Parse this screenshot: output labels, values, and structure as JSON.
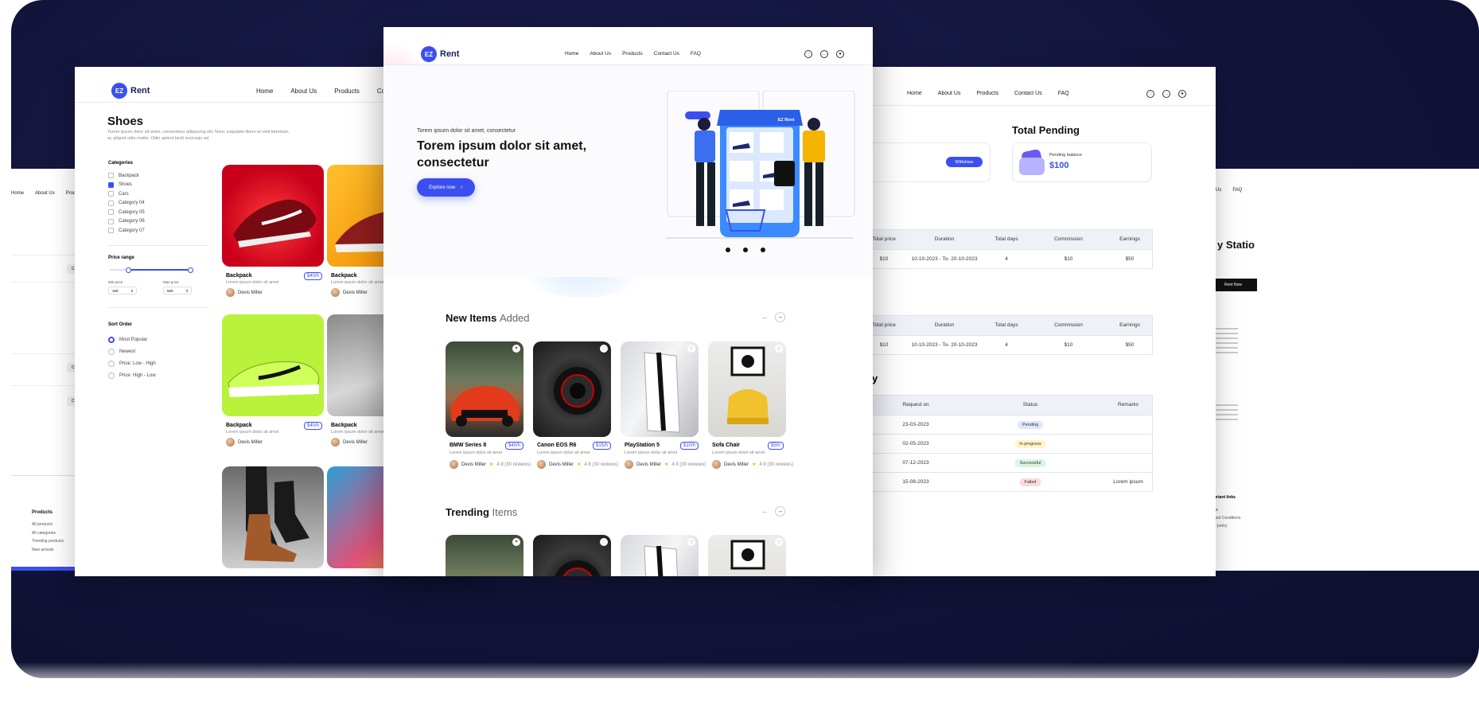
{
  "brand": {
    "name": "Rent",
    "mark": "EZ",
    "accent": "#3b4ff0",
    "dark": "#1b1f5e"
  },
  "nav": {
    "items": [
      "Home",
      "About Us",
      "Products",
      "Contact Us",
      "FAQ"
    ]
  },
  "shop_page": {
    "title": "Shoes",
    "intro_line1": "Torem ipsum dolor sit amet, consectetur adipiscing elit. Nunc vulputate libero et velit interdum,",
    "intro_line2": "ac aliquet odio mattis. Odio aptent taciti sociosqu ad",
    "categories_title": "Categories",
    "categories": [
      {
        "label": "Backpack",
        "checked": false
      },
      {
        "label": "Shoes",
        "checked": true
      },
      {
        "label": "Cars",
        "checked": false
      },
      {
        "label": "Category 04",
        "checked": false
      },
      {
        "label": "Category 05",
        "checked": false
      },
      {
        "label": "Category 06",
        "checked": false
      },
      {
        "label": "Category 07",
        "checked": false
      }
    ],
    "price_range_title": "Price range",
    "min_label": "Min price",
    "max_label": "Max price",
    "min_value": "100",
    "max_value": "500",
    "sort_title": "Sort Order",
    "sort_options": [
      {
        "label": "Most Popular",
        "selected": true
      },
      {
        "label": "Newest",
        "selected": false
      },
      {
        "label": "Price: Low - High",
        "selected": false
      },
      {
        "label": "Price: High - Low",
        "selected": false
      }
    ],
    "products": [
      {
        "name": "Backpack",
        "price": "$40/h",
        "desc": "Lorem ipsum dolor sit amet",
        "owner": "Devis Miller"
      },
      {
        "name": "Backpack",
        "price": "$40/h",
        "desc": "Lorem ipsum dolor sit amet",
        "owner": "Devis Miller"
      },
      {
        "name": "Backpack",
        "price": "$40/h",
        "desc": "Lorem ipsum dolor sit amet",
        "owner": "Devis Miller"
      },
      {
        "name": "Backpack",
        "price": "$40/h",
        "desc": "Lorem ipsum dolor sit amet",
        "owner": "Devis Miller"
      }
    ],
    "footer_title": "Products",
    "footer_links": [
      "All products",
      "All categories",
      "Trending products",
      "New arrivals"
    ]
  },
  "home_page": {
    "hero_kicker": "Torem ipsum dolor sit amet, consectetur",
    "hero_title_line1": "Torem ipsum dolor sit amet,",
    "hero_title_line2": "consectetur",
    "hero_cta": "Explore now",
    "store_sign": "EZ Rent",
    "new_items_title": "New Items",
    "new_items_accent": "Added",
    "trending_title": "Trending",
    "trending_accent": "Items",
    "items": [
      {
        "name": "BMW Series 8",
        "price": "$40/h",
        "desc": "Lorem ipsum dolor sit amet",
        "owner": "Devis Miller",
        "rating": "4.9 (30 reviews)"
      },
      {
        "name": "Canon EOS R6",
        "price": "$15/h",
        "desc": "Lorem ipsum dolor sit amet",
        "owner": "Devis Miller",
        "rating": "4.9 (30 reviews)"
      },
      {
        "name": "PlayStation 5",
        "price": "$10/h",
        "desc": "Lorem ipsum dolor sit amet",
        "owner": "Devis Miller",
        "rating": "4.9 (30 reviews)"
      },
      {
        "name": "Sofa Chair",
        "price": "$5/h",
        "desc": "Lorem ipsum dolor sit amet",
        "owner": "Devis Miller",
        "rating": "4.9 (30 reviews)"
      }
    ]
  },
  "dashboard_page": {
    "withdraw_label": "Withdraw",
    "pending_title": "Total Pending",
    "pending_balance_label": "Pending balance",
    "pending_balance_value": "$100",
    "earnings_headers": [
      "Total price",
      "Duration",
      "Total days",
      "Commission",
      "Earnings"
    ],
    "earnings_rows": [
      [
        "$10",
        "10-10-2023 - To- 20-10-2023",
        "4",
        "$10",
        "$50"
      ],
      [
        "$10",
        "10-10-2023 - To- 20-10-2023",
        "4",
        "$10",
        "$50"
      ]
    ],
    "history_fragment": "y",
    "history_headers": [
      "Request on",
      "Status",
      "Remarks"
    ],
    "history_rows": [
      {
        "date": "23-03-2023",
        "status": "Pending",
        "remarks": ""
      },
      {
        "date": "02-05-2023",
        "status": "In progress",
        "remarks": ""
      },
      {
        "date": "07-12-2023",
        "status": "Successful",
        "remarks": ""
      },
      {
        "date": "15-08-2023",
        "status": "Failed",
        "remarks": "Lorem ipsum"
      }
    ],
    "status_colors": {
      "Pending": "#dfe6ff",
      "In progress": "#fff5c7",
      "Successful": "#d9f5df",
      "Failed": "#ffd9dc"
    }
  },
  "left_back_page": {
    "nav_items": [
      "Home",
      "About Us",
      "Prod"
    ],
    "chip_label": "Cha"
  },
  "right_back_page": {
    "nav_items": [
      "Us",
      "FAQ"
    ],
    "title_fragment": "y Statio",
    "rent_button": "Rent Now",
    "links_title": "ortant links",
    "links": [
      "us",
      "and Conditions",
      "y policy"
    ]
  }
}
